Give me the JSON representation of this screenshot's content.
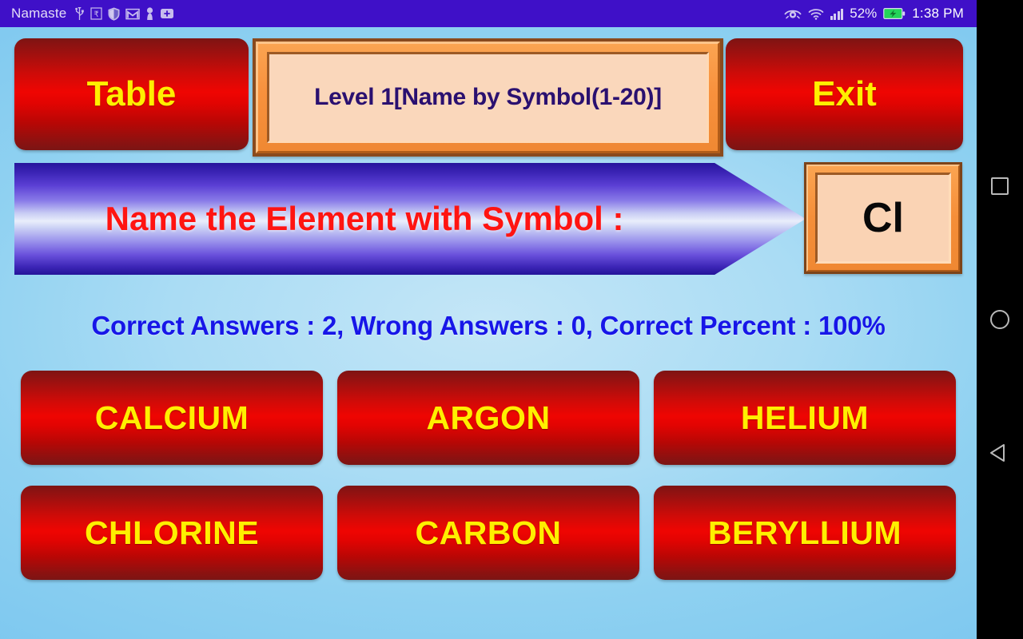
{
  "statusbar": {
    "carrier": "Namaste",
    "icons": [
      "usb-icon",
      "rupee-icon",
      "shield-icon",
      "gmail-icon",
      "person-icon",
      "plus-box-icon"
    ],
    "right_icons": [
      "eye-care-icon",
      "wifi-icon",
      "signal-icon"
    ],
    "battery_percent": "52%",
    "battery_state": "charging",
    "time": "1:38 PM",
    "bg_color": "#3f10c8"
  },
  "navbar": {
    "items": [
      {
        "name": "recents-button",
        "glyph": "square"
      },
      {
        "name": "home-button",
        "glyph": "circle"
      },
      {
        "name": "back-button",
        "glyph": "triangle"
      }
    ]
  },
  "topbar": {
    "table_label": "Table",
    "level_label": "Level 1[Name by Symbol(1-20)]",
    "exit_label": "Exit"
  },
  "question": {
    "prompt": "Name the Element with Symbol :",
    "symbol": "Cl"
  },
  "score": {
    "line": "Correct Answers : 2, Wrong Answers : 0, Correct Percent : 100%",
    "correct_answers": 2,
    "wrong_answers": 0,
    "correct_percent": "100%"
  },
  "answers": [
    {
      "label": "CALCIUM"
    },
    {
      "label": "ARGON"
    },
    {
      "label": "HELIUM"
    },
    {
      "label": "CHLORINE"
    },
    {
      "label": "CARBON"
    },
    {
      "label": "BERYLLIUM"
    }
  ],
  "colors": {
    "status_bar": "#3f10c8",
    "button_red": "#e20402",
    "button_text": "#ffef00",
    "frame_orange": "#f58e38",
    "frame_fill": "#fad7bb",
    "level_text": "#2a1070",
    "prompt_red": "#ff1411",
    "score_blue": "#1716e8",
    "background": "#aadcf4"
  }
}
